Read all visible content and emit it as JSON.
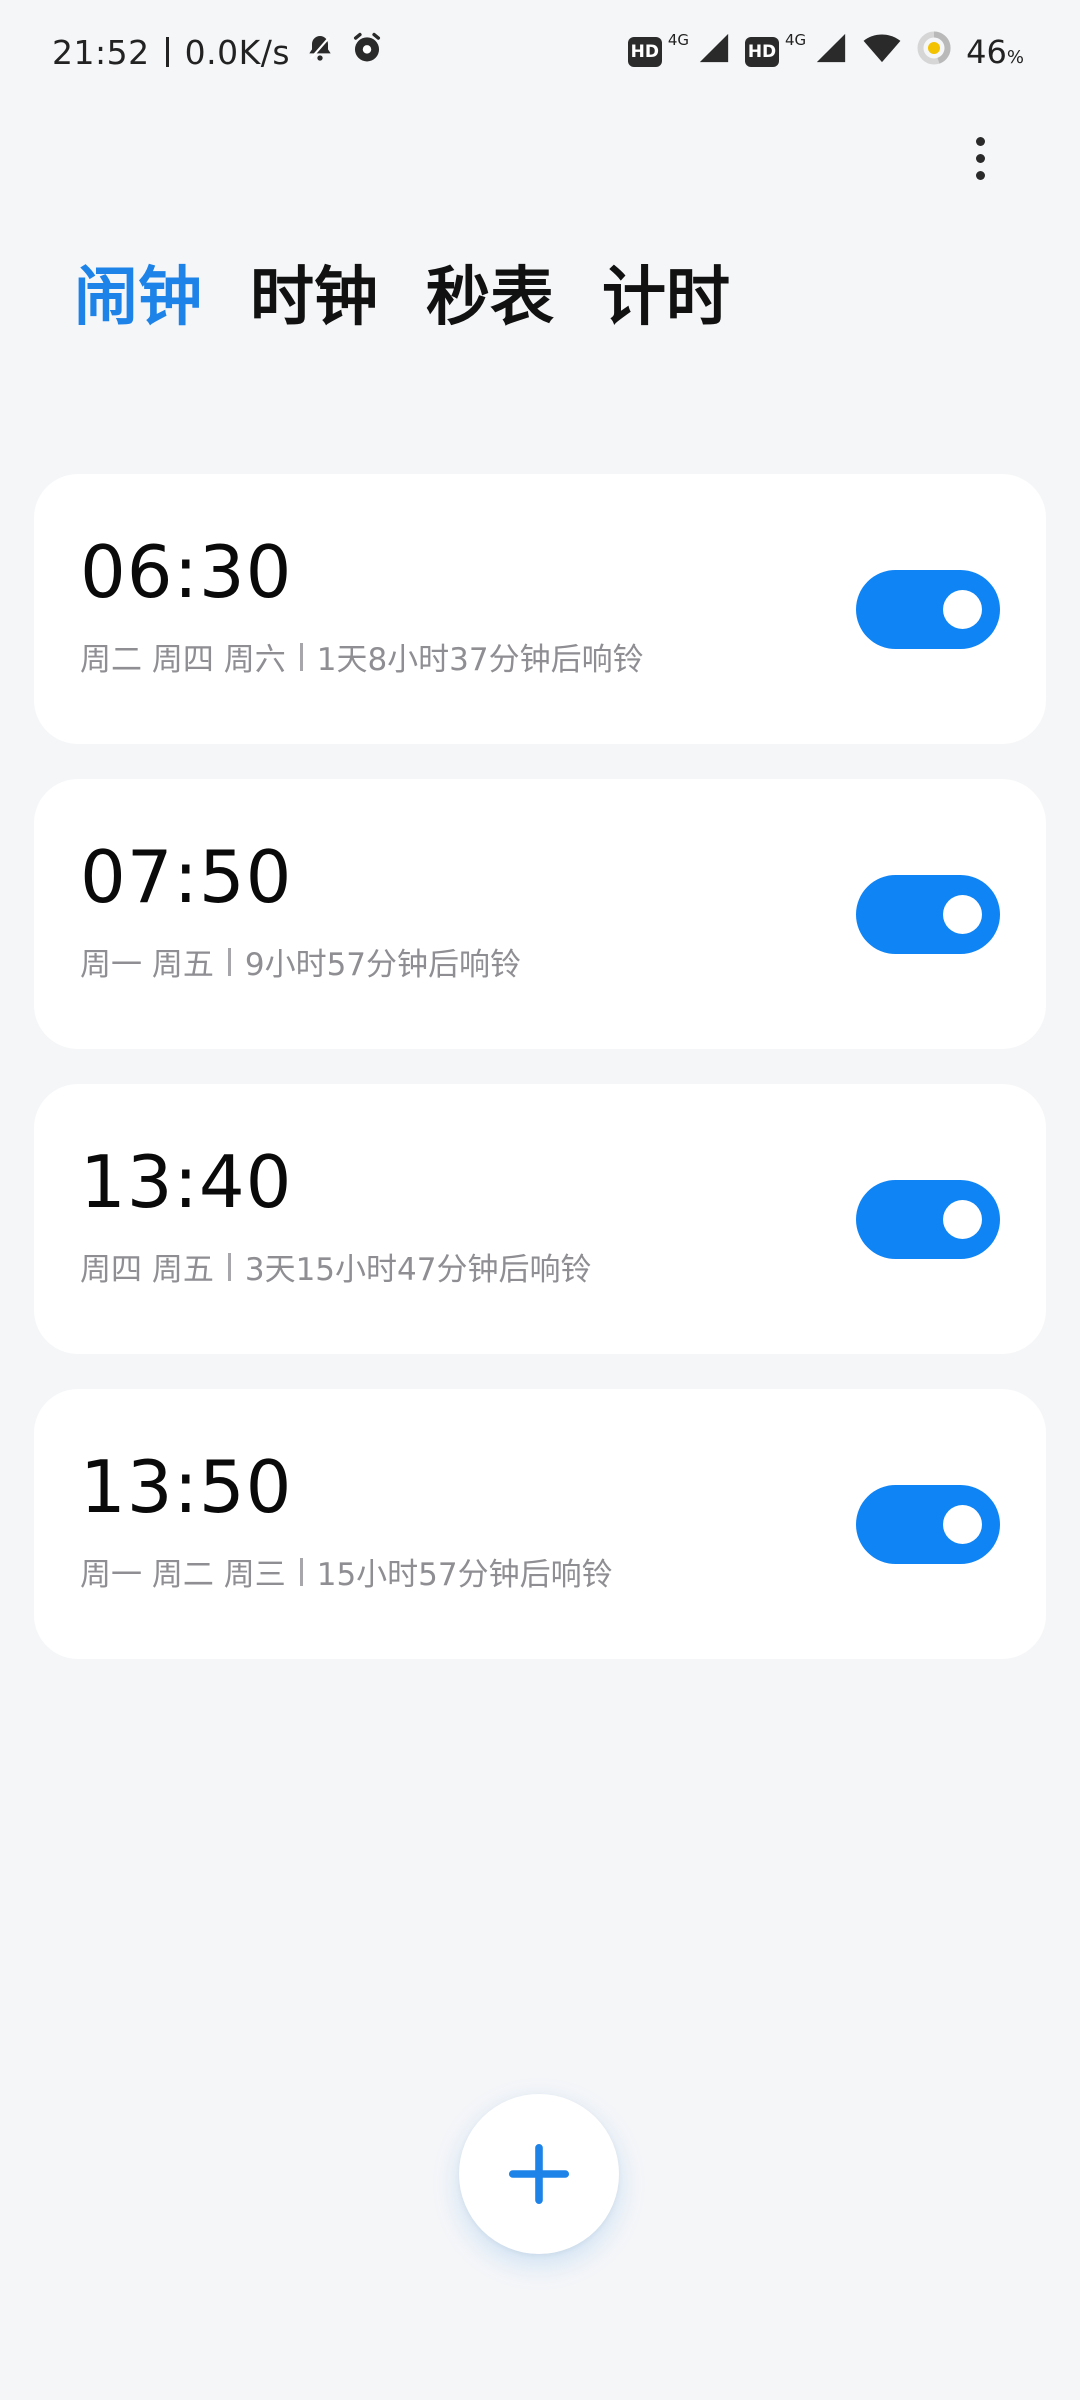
{
  "status_bar": {
    "time": "21:52",
    "net_speed": "0.0K/s",
    "hd_label": "HD",
    "net_type": "4G",
    "battery_percent": "46",
    "battery_unit": "%"
  },
  "tabs": [
    {
      "label": "闹钟",
      "active": true
    },
    {
      "label": "时钟",
      "active": false
    },
    {
      "label": "秒表",
      "active": false
    },
    {
      "label": "计时",
      "active": false
    }
  ],
  "alarms": [
    {
      "time": "06:30",
      "days": "周二 周四 周六",
      "remaining": "1天8小时37分钟后响铃",
      "enabled": true
    },
    {
      "time": "07:50",
      "days": "周一 周五",
      "remaining": "9小时57分钟后响铃",
      "enabled": true
    },
    {
      "time": "13:40",
      "days": "周四 周五",
      "remaining": "3天15小时47分钟后响铃",
      "enabled": true
    },
    {
      "time": "13:50",
      "days": "周一 周二 周三",
      "remaining": "15小时57分钟后响铃",
      "enabled": true
    }
  ],
  "colors": {
    "accent": "#1e83e8",
    "toggle_on": "#0f84f5",
    "background": "#f5f6f8",
    "card": "#ffffff",
    "secondary_text": "#8e8e93"
  },
  "icons": {
    "more": "more-vertical-icon",
    "add": "plus-icon",
    "notification": "bell-icon",
    "alarm_status": "alarm-clock-icon",
    "wifi": "wifi-icon",
    "signal": "signal-icon",
    "battery": "battery-ring-icon"
  }
}
